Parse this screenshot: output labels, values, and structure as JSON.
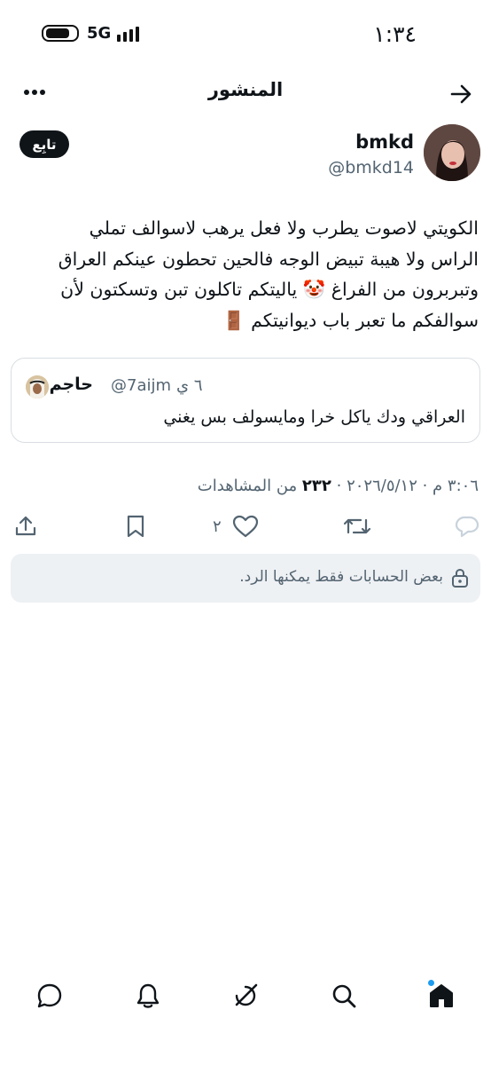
{
  "status_bar": {
    "time": "١:٣٤",
    "network": "5G"
  },
  "header": {
    "title": "المنشور"
  },
  "post": {
    "author_name": "bmkd",
    "author_handle": "@bmkd14",
    "follow_label": "تابِع",
    "text": "الكويتي لاصوت يطرب ولا فعل يرهب لاسوالف  تملي\nالراس ولا هيبة تبيض الوجه فالحين تحطون عينكم العراق\nوتبربرون من الفراغ 🤡 ياليتكم تاكلون  تبن وتسكتون لأن\nسوالفكم  ما تعبر باب ديوانيتكم 🚪",
    "quoted": {
      "name": "حاجم",
      "handle": "@7aijm",
      "time": "٦ ي",
      "text": "العراقي ودك ياكل خرا ومايسولف بس يغني"
    },
    "timestamp": "٣:٠٦ م · ٢٠٢٦/٥/١٢ ·",
    "views_count": "٢٣٢",
    "views_label": "من المشاهدات",
    "like_count": "٢",
    "restricted_reply": "بعض الحسابات فقط يمكنها الرد."
  },
  "icons": {
    "back": "arrow-right-icon",
    "more": "more-dots-icon",
    "share": "share-icon",
    "bookmark": "bookmark-icon",
    "like": "heart-icon",
    "retweet": "retweet-icon",
    "reply": "reply-icon",
    "lock": "lock-icon",
    "nav": [
      "messages-icon",
      "notifications-icon",
      "grok-icon",
      "search-icon",
      "home-icon"
    ]
  },
  "colors": {
    "accent": "#1d9bf0",
    "text": "#0f1419",
    "secondary": "#536471",
    "follow_bg": "#0f1419"
  }
}
